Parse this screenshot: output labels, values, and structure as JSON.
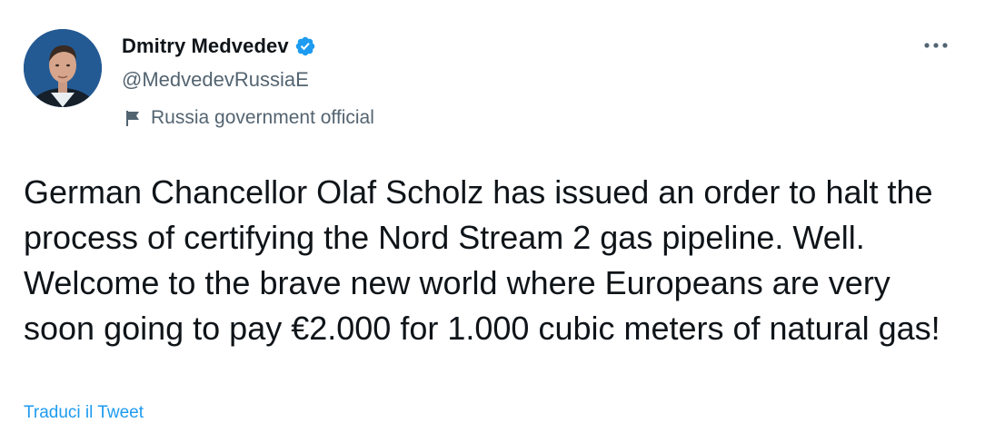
{
  "tweet": {
    "author": {
      "display_name": "Dmitry Medvedev",
      "handle": "@MedvedevRussiaE",
      "verified": true,
      "label": "Russia government official",
      "avatar_icon": "profile-photo"
    },
    "text": "German Chancellor Olaf Scholz has issued an order to halt the process of certifying the Nord Stream 2 gas pipeline. Well. Welcome to the brave new world where Europeans are very soon going to pay €2.000 for 1.000 cubic meters of natural gas!",
    "translate_label": "Traduci il Tweet",
    "more_icon": "ellipsis-icon"
  },
  "colors": {
    "text_primary": "#0f1419",
    "text_secondary": "#536471",
    "link": "#1d9bf0",
    "verified_badge": "#1d9bf0"
  }
}
